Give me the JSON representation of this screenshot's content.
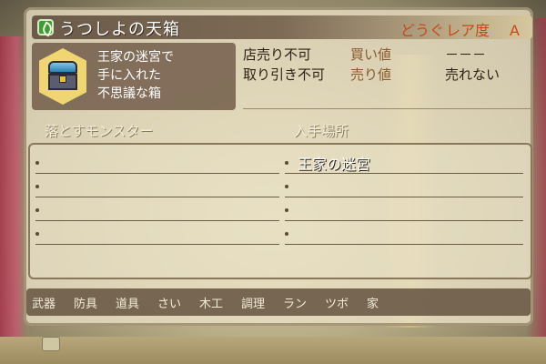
{
  "item": {
    "name": "うつしよの天箱",
    "category": "どうぐ",
    "rarity_label": "レア度",
    "rarity_value": "A",
    "description": [
      "王家の迷宮で",
      "手に入れた",
      "不思議な箱"
    ],
    "icon": "treasure-chest-icon"
  },
  "price": {
    "sell_status": "店売り不可",
    "buy_label": "買い値",
    "buy_value": "－－－",
    "trade_status": "取り引き不可",
    "sell_label": "売り値",
    "sell_value": "売れない"
  },
  "headers": {
    "monsters": "落とすモンスター",
    "locations": "入手場所"
  },
  "monsters": [
    "",
    "",
    "",
    ""
  ],
  "locations": [
    "王家の迷宮",
    "",
    "",
    ""
  ],
  "tabs": [
    "武器",
    "防具",
    "道具",
    "さい",
    "木工",
    "調理",
    "ラン",
    "ツボ",
    "家"
  ],
  "colors": {
    "accent": "#c84a17",
    "panel": "#ebe2c6",
    "title_bar": "#6b5a48",
    "tab_bar": "#645240"
  }
}
